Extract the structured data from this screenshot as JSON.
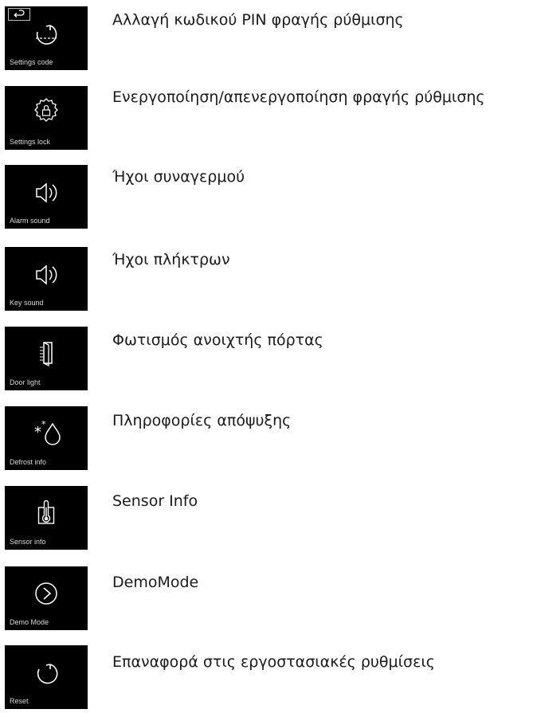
{
  "items": [
    {
      "tile_label": "Settings code",
      "icon": "settings-code-icon",
      "description": "Αλλαγή κωδικού PIN φραγής ρύθμισης"
    },
    {
      "tile_label": "Settings lock",
      "icon": "settings-lock-icon",
      "description_line1": "Ενεργοποίηση/απενεργοποίηση φραγής",
      "description_line2": "ρύθμισης"
    },
    {
      "tile_label": "Alarm sound",
      "icon": "speaker-icon",
      "description": "Ήχοι συναγερμού"
    },
    {
      "tile_label": "Key sound",
      "icon": "speaker-icon",
      "description": "Ήχοι πλήκτρων"
    },
    {
      "tile_label": "Door light",
      "icon": "door-light-icon",
      "description": "Φωτισμός ανοιχτής πόρτας"
    },
    {
      "tile_label": "Defrost info",
      "icon": "defrost-icon",
      "description": "Πληροφορίες απόψυξης"
    },
    {
      "tile_label": "Sensor info",
      "icon": "thermometer-icon",
      "description": "Sensor Info"
    },
    {
      "tile_label": "Demo Mode",
      "icon": "play-circle-icon",
      "description": "DemoMode"
    },
    {
      "tile_label": "Reset",
      "icon": "reset-icon",
      "description": "Επαναφορά στις εργοστασιακές ρυθμίσεις"
    }
  ]
}
